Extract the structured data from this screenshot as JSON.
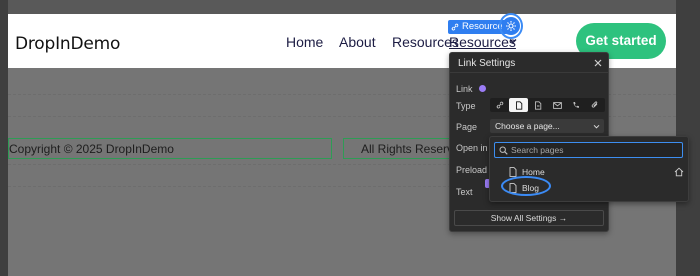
{
  "site": {
    "brand": "DropInDemo",
    "nav": [
      "Home",
      "About",
      "Resources",
      "Resources"
    ],
    "cta": "Get started",
    "footer": {
      "copyright": "Copyright © 2025 DropInDemo",
      "rights": "All Rights Reserv"
    }
  },
  "editor": {
    "element_tag": "Resource",
    "gear_icon": "gear-icon"
  },
  "link_settings": {
    "title": "Link Settings",
    "labels": {
      "link": "Link",
      "type": "Type",
      "page": "Page",
      "open_in": "Open in",
      "preload": "Preload",
      "text": "Text"
    },
    "type_options": [
      "link-icon",
      "page-icon",
      "section-icon",
      "email-icon",
      "phone-icon",
      "attachment-icon"
    ],
    "selected_type": "page-icon",
    "page_select_value": "Choose a page...",
    "show_all": "Show All Settings →",
    "accent_color": "#9b7cf5"
  },
  "page_dropdown": {
    "search_placeholder": "Search pages",
    "items": [
      {
        "label": "Home",
        "icon": "page-icon",
        "is_home": true
      },
      {
        "label": "Blog",
        "icon": "page-icon",
        "highlighted": true
      }
    ]
  },
  "colors": {
    "cta": "#2ec27e",
    "selection": "#3b8bf5",
    "panel_bg": "#2b2b2b"
  }
}
